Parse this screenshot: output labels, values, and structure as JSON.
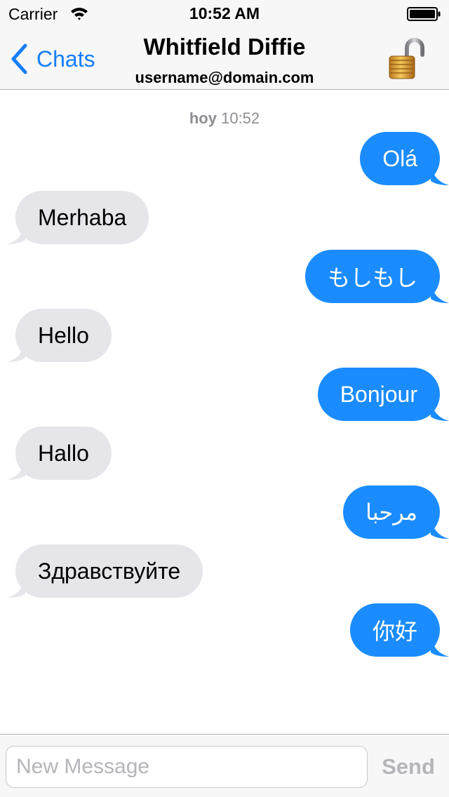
{
  "status_bar": {
    "carrier": "Carrier",
    "time": "10:52 AM"
  },
  "nav": {
    "back_label": "Chats",
    "title": "Whitfield Diffie",
    "subtitle": "username@domain.com",
    "lock_icon": "unlocked-padlock-icon"
  },
  "conversation": {
    "timestamp_day": "hoy",
    "timestamp_time": "10:52",
    "messages": [
      {
        "direction": "out",
        "text": "Olá"
      },
      {
        "direction": "in",
        "text": "Merhaba"
      },
      {
        "direction": "out",
        "text": "もしもし"
      },
      {
        "direction": "in",
        "text": "Hello"
      },
      {
        "direction": "out",
        "text": "Bonjour"
      },
      {
        "direction": "in",
        "text": "Hallo"
      },
      {
        "direction": "out",
        "text": "مرحبا"
      },
      {
        "direction": "in",
        "text": "Здравствуйте"
      },
      {
        "direction": "out",
        "text": "你好"
      }
    ]
  },
  "composer": {
    "value": "",
    "placeholder": "New Message",
    "send_label": "Send"
  },
  "colors": {
    "accent": "#157efb",
    "outgoing_bubble": "#1a8cff",
    "incoming_bubble": "#e5e5ea",
    "muted": "#8e8e93"
  }
}
